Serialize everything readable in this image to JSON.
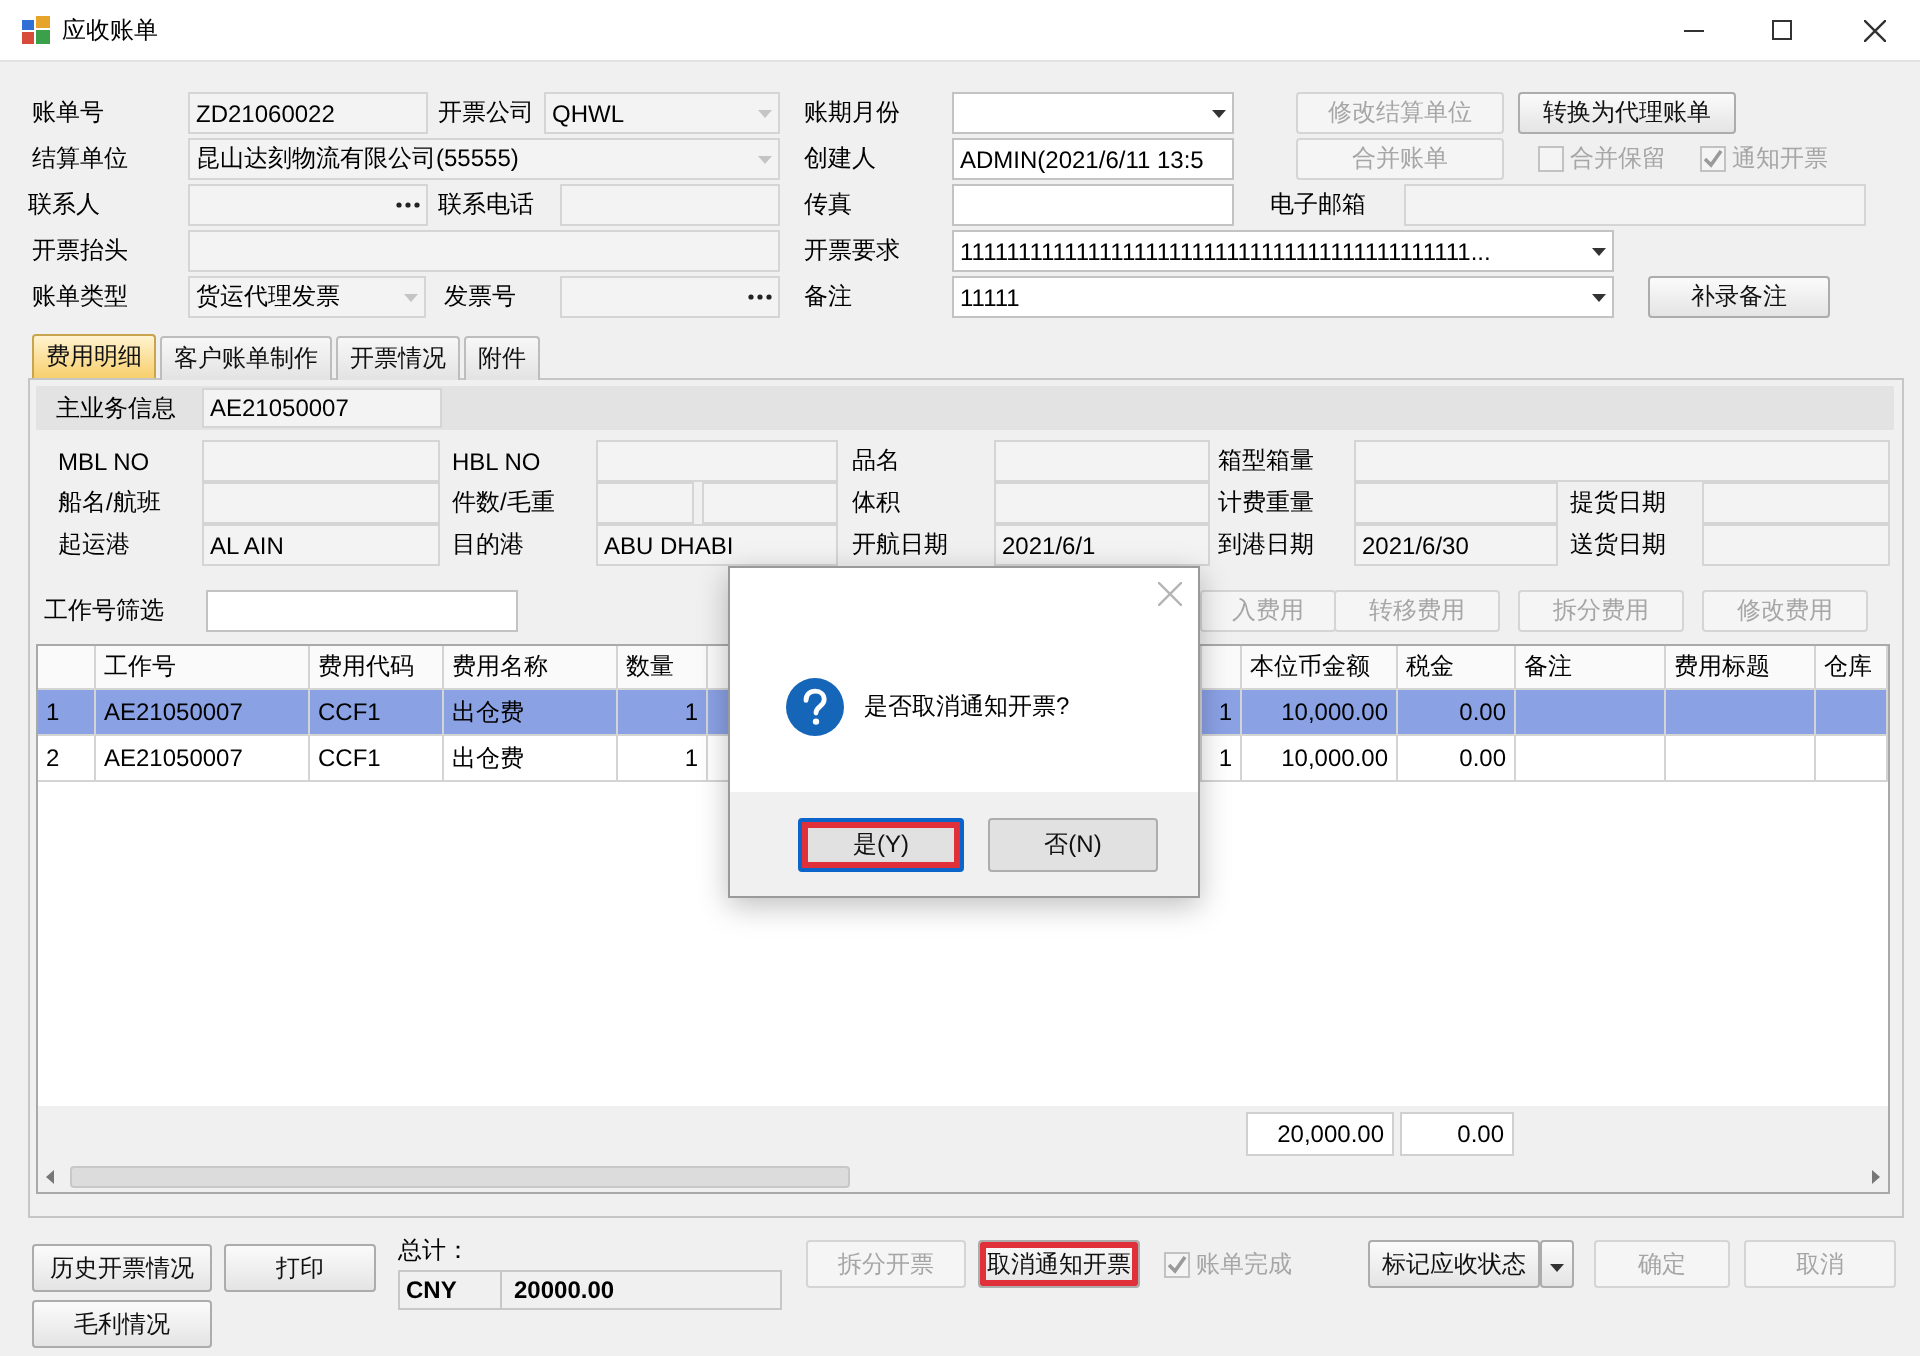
{
  "window": {
    "title": "应收账单"
  },
  "header": {
    "fields": [
      {
        "kind": "label",
        "text": "账单号"
      },
      {
        "kind": "text",
        "value": "ZD21060022",
        "disabled": true
      },
      {
        "kind": "label",
        "text": "开票公司"
      },
      {
        "kind": "combo",
        "value": "QHWL",
        "disabled": true
      },
      {
        "kind": "label",
        "text": "账期月份"
      },
      {
        "kind": "combo",
        "disabled": false
      },
      {
        "kind": "button",
        "label": "修改结算单位",
        "disabled": true
      },
      {
        "kind": "button",
        "label": "转换为代理账单",
        "disabled": false
      },
      {
        "kind": "label",
        "text": "结算单位"
      },
      {
        "kind": "combo",
        "value": "昆山达刻物流有限公司(55555)",
        "disabled": true
      },
      {
        "kind": "label",
        "text": "创建人"
      },
      {
        "kind": "text",
        "value": "ADMIN(2021/6/11 13:5",
        "disabled": false
      },
      {
        "kind": "button",
        "label": "合并账单",
        "disabled": true
      },
      {
        "kind": "check",
        "label": "合并保留",
        "checked": false,
        "disabled": true
      },
      {
        "kind": "check",
        "label": "通知开票",
        "checked": true,
        "disabled": true
      },
      {
        "kind": "label",
        "text": "联系人"
      },
      {
        "kind": "lookup",
        "disabled": true
      },
      {
        "kind": "label",
        "text": "联系电话"
      },
      {
        "kind": "text",
        "disabled": true
      },
      {
        "kind": "label",
        "text": "传真"
      },
      {
        "kind": "text",
        "disabled": false
      },
      {
        "kind": "label",
        "text": "电子邮箱"
      },
      {
        "kind": "text",
        "disabled": true
      },
      {
        "kind": "label",
        "text": "开票抬头"
      },
      {
        "kind": "text",
        "disabled": true
      },
      {
        "kind": "label",
        "text": "开票要求"
      },
      {
        "kind": "combo",
        "value": "11111111111111111111111111111111111111111111...",
        "disabled": false
      },
      {
        "kind": "label",
        "text": "账单类型"
      },
      {
        "kind": "combo",
        "value": "货运代理发票",
        "disabled": true
      },
      {
        "kind": "label",
        "text": "发票号"
      },
      {
        "kind": "lookup",
        "disabled": true
      },
      {
        "kind": "label",
        "text": "备注"
      },
      {
        "kind": "combo",
        "value": "11111",
        "disabled": false
      },
      {
        "kind": "button",
        "label": "补录备注",
        "disabled": false
      }
    ]
  },
  "tabs": [
    {
      "label": "费用明细",
      "selected": true
    },
    {
      "label": "客户账单制作",
      "selected": false
    },
    {
      "label": "开票情况",
      "selected": false
    },
    {
      "label": "附件",
      "selected": false
    }
  ],
  "detail": {
    "main": [
      {
        "kind": "label",
        "text": "主业务信息"
      },
      {
        "kind": "text",
        "value": "AE21050007",
        "disabled": true
      }
    ],
    "fields": [
      {
        "kind": "label",
        "text": "MBL NO"
      },
      {
        "kind": "text",
        "disabled": true
      },
      {
        "kind": "label",
        "text": "HBL NO"
      },
      {
        "kind": "text",
        "disabled": true
      },
      {
        "kind": "label",
        "text": "品名"
      },
      {
        "kind": "text",
        "disabled": true
      },
      {
        "kind": "label",
        "text": "箱型箱量"
      },
      {
        "kind": "text",
        "disabled": true
      },
      {
        "kind": "label",
        "text": "船名/航班"
      },
      {
        "kind": "text",
        "disabled": true
      },
      {
        "kind": "label",
        "text": "件数/毛重"
      },
      {
        "kind": "text",
        "disabled": true
      },
      {
        "kind": "text",
        "disabled": true
      },
      {
        "kind": "label",
        "text": "体积"
      },
      {
        "kind": "text",
        "disabled": true
      },
      {
        "kind": "label",
        "text": "计费重量"
      },
      {
        "kind": "text",
        "disabled": true
      },
      {
        "kind": "label",
        "text": "提货日期"
      },
      {
        "kind": "text",
        "disabled": true
      },
      {
        "kind": "label",
        "text": "起运港"
      },
      {
        "kind": "text",
        "value": "AL AIN",
        "disabled": true
      },
      {
        "kind": "label",
        "text": "目的港"
      },
      {
        "kind": "text",
        "value": "ABU DHABI",
        "disabled": true
      },
      {
        "kind": "label",
        "text": "开航日期"
      },
      {
        "kind": "text",
        "value": "2021/6/1",
        "disabled": true
      },
      {
        "kind": "label",
        "text": "到港日期"
      },
      {
        "kind": "text",
        "value": "2021/6/30",
        "disabled": true
      },
      {
        "kind": "label",
        "text": "送货日期"
      },
      {
        "kind": "text",
        "disabled": true
      }
    ]
  },
  "filter": {
    "items": [
      {
        "kind": "label",
        "text": "工作号筛选"
      },
      {
        "kind": "text",
        "disabled": false
      },
      {
        "kind": "button",
        "label": "入费用",
        "disabled": true
      },
      {
        "kind": "button",
        "label": "转移费用",
        "disabled": true
      },
      {
        "kind": "button",
        "label": "拆分费用",
        "disabled": true
      },
      {
        "kind": "button",
        "label": "修改费用",
        "disabled": true
      }
    ]
  },
  "table": {
    "columns": [
      null,
      "工作号",
      "费用代码",
      "费用名称",
      "数量",
      null,
      null,
      "本位币金额",
      "税金",
      "备注",
      "费用标题",
      "仓库"
    ],
    "rows": [
      {
        "cells": [
          "1",
          "AE21050007",
          "CCF1",
          "出仓费",
          "1",
          null,
          "1",
          "10,000.00",
          "0.00",
          null,
          null,
          null
        ],
        "selected": true
      },
      {
        "cells": [
          "2",
          "AE21050007",
          "CCF1",
          "出仓费",
          "1",
          null,
          "1",
          "10,000.00",
          "0.00",
          null,
          null,
          null
        ],
        "selected": false
      }
    ],
    "totals": [
      "20,000.00",
      "0.00"
    ]
  },
  "footer": {
    "buttons": [
      {
        "label": "历史开票情况"
      },
      {
        "label": "打印"
      },
      {
        "label": "毛利情况"
      }
    ],
    "total": {
      "label": "总计：",
      "currency": "CNY",
      "amount": "20000.00"
    },
    "actions": [
      {
        "kind": "button",
        "label": "拆分开票",
        "disabled": true,
        "highlighted": false
      },
      {
        "kind": "button",
        "label": "取消通知开票",
        "disabled": false,
        "highlighted": true
      },
      {
        "kind": "check",
        "label": "账单完成",
        "checked": true,
        "disabled": true,
        "highlighted": false
      },
      {
        "kind": "split_button",
        "label": "标记应收状态",
        "disabled": false,
        "highlighted": false
      },
      {
        "kind": "button",
        "label": "确定",
        "disabled": true,
        "highlighted": false
      },
      {
        "kind": "button",
        "label": "取消",
        "disabled": true,
        "highlighted": false
      }
    ]
  },
  "dialog": {
    "message": "是否取消通知开票?",
    "buttons": [
      {
        "label": "是(Y)",
        "default": true,
        "highlighted": true
      },
      {
        "label": "否(N)",
        "default": false,
        "highlighted": false
      }
    ]
  }
}
